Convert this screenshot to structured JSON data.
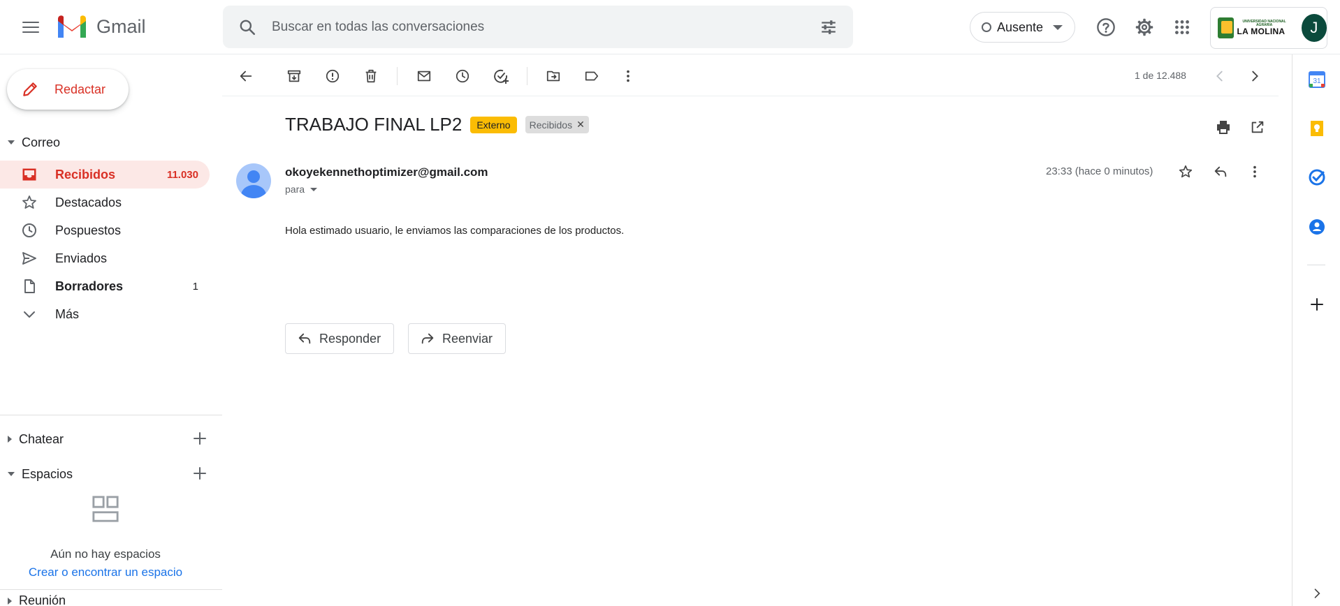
{
  "app": {
    "name": "Gmail"
  },
  "search": {
    "placeholder": "Buscar en todas las conversaciones"
  },
  "status": {
    "label": "Ausente"
  },
  "account": {
    "org_small": "UNIVERSIDAD NACIONAL AGRARIA",
    "org_name": "LA MOLINA",
    "avatar_letter": "J"
  },
  "sidebar": {
    "compose_label": "Redactar",
    "mail_section": "Correo",
    "items": [
      {
        "label": "Recibidos",
        "count": "11.030",
        "icon": "inbox-icon",
        "active": true
      },
      {
        "label": "Destacados",
        "count": "",
        "icon": "star-icon"
      },
      {
        "label": "Pospuestos",
        "count": "",
        "icon": "clock-icon"
      },
      {
        "label": "Enviados",
        "count": "",
        "icon": "send-icon"
      },
      {
        "label": "Borradores",
        "count": "1",
        "icon": "draft-icon"
      },
      {
        "label": "Más",
        "count": "",
        "icon": "chevron-down-icon"
      }
    ],
    "chat_section": "Chatear",
    "spaces_section": "Espacios",
    "no_spaces": "Aún no hay espacios",
    "create_space": "Crear o encontrar un espacio",
    "meet_section": "Reunión"
  },
  "toolbar": {
    "counter": "1 de 12.488"
  },
  "email": {
    "subject": "TRABAJO FINAL LP2",
    "badge_external": "Externo",
    "label_chip": "Recibidos",
    "sender": "okoyekennethoptimizer@gmail.com",
    "to": "para",
    "timestamp": "23:33 (hace 0 minutos)",
    "body": "Hola estimado usuario, le enviamos las comparaciones de los productos."
  },
  "actions": {
    "reply": "Responder",
    "forward": "Reenviar"
  },
  "side_panel": {
    "calendar_day": "31"
  },
  "colors": {
    "accent_red": "#d93025",
    "active_bg": "#fce8e6",
    "link_blue": "#1a73e8",
    "external_badge": "#fbbc04"
  }
}
